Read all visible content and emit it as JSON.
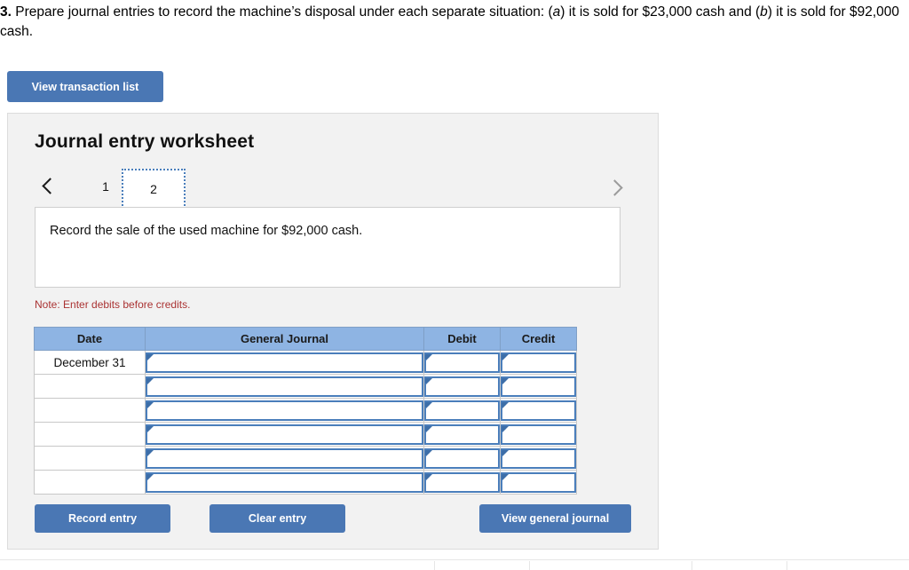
{
  "question": {
    "number": "3.",
    "text_part1": " Prepare journal entries to record the machine’s disposal under each separate situation: (",
    "italic_a": "a",
    "text_part2": ") it is sold for $23,000 cash and (",
    "italic_b": "b",
    "text_part3": ") it is sold for $92,000 cash."
  },
  "toolbar": {
    "view_transaction_list_label": "View transaction list"
  },
  "worksheet": {
    "title": "Journal entry worksheet",
    "pager": {
      "prev_icon": "chevron-left-icon",
      "next_icon": "chevron-right-icon",
      "tabs": [
        {
          "label": "1",
          "active": false
        },
        {
          "label": "2",
          "active": true
        }
      ]
    },
    "instruction": "Record the sale of the used machine for $92,000 cash.",
    "note": "Note: Enter debits before credits."
  },
  "table": {
    "columns": [
      "Date",
      "General Journal",
      "Debit",
      "Credit"
    ],
    "rows": [
      {
        "date": "December 31",
        "general_journal": "",
        "debit": "",
        "credit": ""
      },
      {
        "date": "",
        "general_journal": "",
        "debit": "",
        "credit": ""
      },
      {
        "date": "",
        "general_journal": "",
        "debit": "",
        "credit": ""
      },
      {
        "date": "",
        "general_journal": "",
        "debit": "",
        "credit": ""
      },
      {
        "date": "",
        "general_journal": "",
        "debit": "",
        "credit": ""
      },
      {
        "date": "",
        "general_journal": "",
        "debit": "",
        "credit": ""
      }
    ]
  },
  "footer": {
    "record_entry_label": "Record entry",
    "clear_entry_label": "Clear entry",
    "view_general_journal_label": "View general journal"
  },
  "colors": {
    "button_blue": "#4a77b4",
    "table_header_blue": "#8eb4e3",
    "input_border_blue": "#4a7ebb",
    "note_red": "#aa3333",
    "panel_background": "#f2f2f2"
  }
}
